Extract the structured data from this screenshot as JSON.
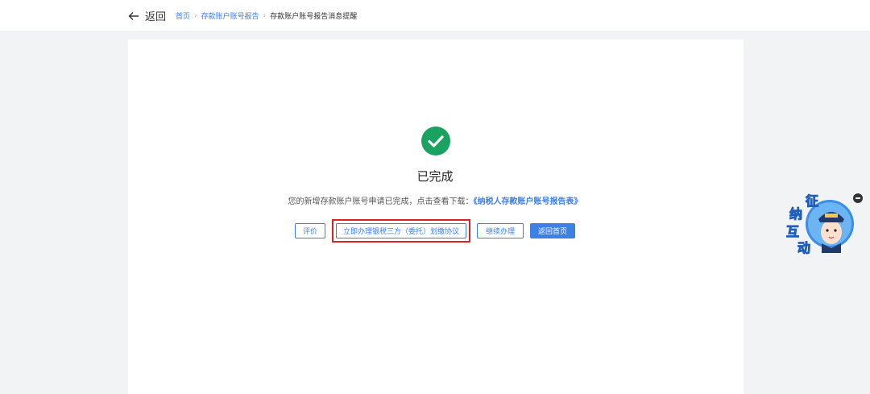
{
  "header": {
    "back_label": "返回",
    "breadcrumb": [
      {
        "label": "首页",
        "link": true
      },
      {
        "label": "存款账户账号报告",
        "link": true
      },
      {
        "label": "存款账户账号报告消息提醒",
        "link": false
      }
    ]
  },
  "result": {
    "title": "已完成",
    "message_prefix": "您的新增存款账户账号申请已完成，点击查看下载：",
    "download_link": "《纳税人存款账户账号报告表》"
  },
  "actions": {
    "evaluate_label": "评价",
    "agreement_label": "立即办理银税三方（委托）划缴协议",
    "continue_label": "继续办理",
    "home_label": "返回首页"
  },
  "widget": {
    "chars": [
      "征",
      "纳",
      "互",
      "动"
    ]
  },
  "colors": {
    "accent": "#3c80e6",
    "success": "#1aa261",
    "highlight": "#e02020"
  }
}
